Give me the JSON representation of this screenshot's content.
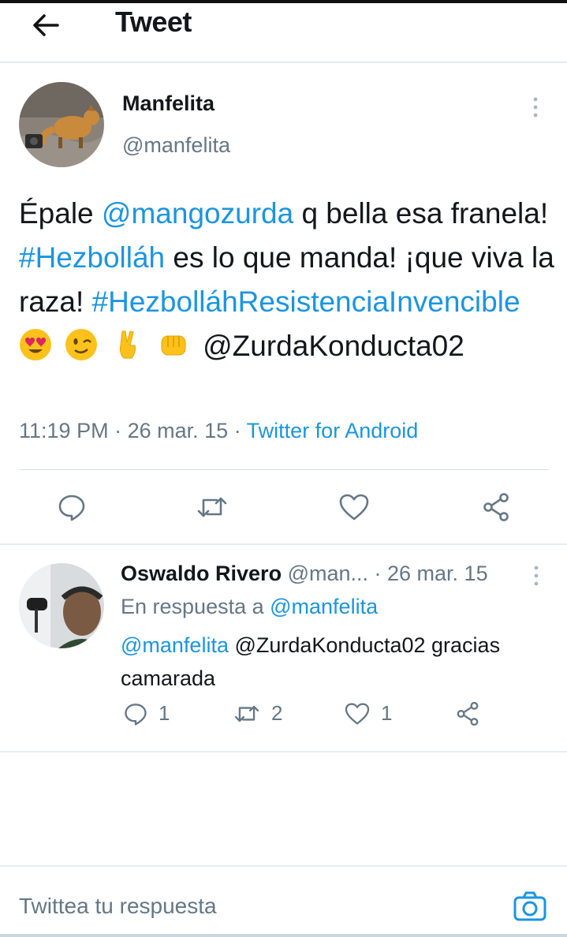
{
  "header": {
    "title": "Tweet",
    "back_icon": "arrow-left-icon"
  },
  "tweet": {
    "author_name": "Manfelita",
    "author_handle": "@manfelita",
    "text": {
      "w1": "Épale ",
      "mention1": "@mangozurda",
      "w2": " q bella esa franela! ",
      "hashtag1": "#Hezbolláh",
      "w3": " es lo que manda! ¡que viva la raza! ",
      "hashtag2": "#HezbolláhResistenciaInvencible",
      "emojis": [
        "heart-eyes-emoji",
        "winking-face-emoji",
        "victory-hand-emoji",
        "oncoming-fist-emoji"
      ],
      "w4": " @ZurdaKonducta02"
    },
    "time": "11:19 PM",
    "sep1": " · ",
    "date": "26 mar. 15",
    "sep2": " · ",
    "source": "Twitter for Android"
  },
  "reply": {
    "author_name": "Oswaldo Rivero",
    "author_handle": "@man...",
    "dot": " · ",
    "date": "26 mar. 15",
    "reply_to_label": "En respuesta a ",
    "reply_to_handle": "@manfelita",
    "text_mention": "@manfelita",
    "text_rest": " @ZurdaKonducta02 gracias camarada",
    "counts": {
      "replies": "1",
      "retweets": "2",
      "likes": "1"
    }
  },
  "composer": {
    "placeholder": "Twittea tu respuesta",
    "camera_icon": "camera-icon"
  },
  "colors": {
    "link": "#1b95e0",
    "secondary_text": "#657786",
    "divider": "#e6ecf0"
  }
}
